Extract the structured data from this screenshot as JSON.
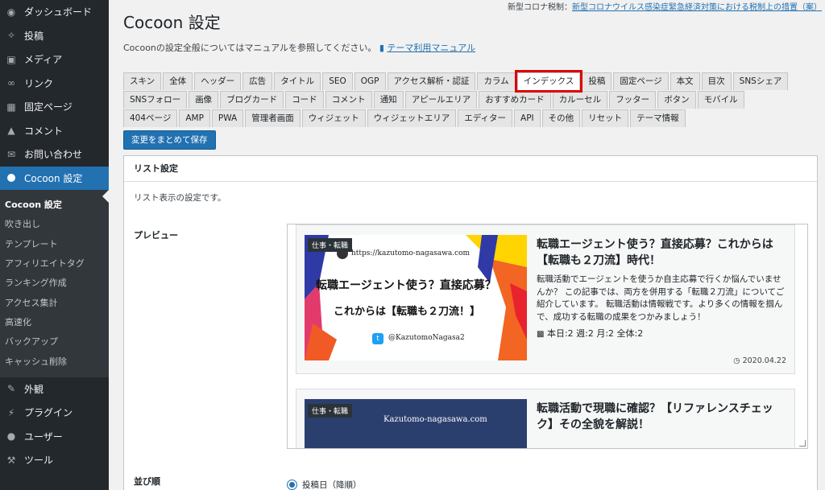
{
  "sidebar": {
    "top_items": [
      {
        "label": "ダッシュボード",
        "icon": "dashboard-icon"
      },
      {
        "label": "投稿",
        "icon": "pin-icon"
      },
      {
        "label": "メディア",
        "icon": "media-icon"
      },
      {
        "label": "リンク",
        "icon": "link-icon"
      },
      {
        "label": "固定ページ",
        "icon": "page-icon"
      },
      {
        "label": "コメント",
        "icon": "comment-icon"
      },
      {
        "label": "お問い合わせ",
        "icon": "mail-icon"
      }
    ],
    "active_item": {
      "label": "Cocoon 設定",
      "icon": "cocoon-icon"
    },
    "submenu": [
      "Cocoon 設定",
      "吹き出し",
      "テンプレート",
      "アフィリエイトタグ",
      "ランキング作成",
      "アクセス集計",
      "高速化",
      "バックアップ",
      "キャッシュ削除"
    ],
    "bottom_items": [
      {
        "label": "外観",
        "icon": "appearance-icon"
      },
      {
        "label": "プラグイン",
        "icon": "plugin-icon"
      },
      {
        "label": "ユーザー",
        "icon": "user-icon"
      },
      {
        "label": "ツール",
        "icon": "tool-icon"
      }
    ]
  },
  "notice": {
    "prefix": "新型コロナ税制：",
    "link": "新型コロナウイルス感染症緊急経済対策における税制上の措置（案）"
  },
  "page_title": "Cocoon 設定",
  "intro": {
    "text": "Cocoonの設定全般についてはマニュアルを参照してください。",
    "link": "テーマ利用マニュアル"
  },
  "tabs": {
    "row1": [
      "スキン",
      "全体",
      "ヘッダー",
      "広告",
      "タイトル",
      "SEO",
      "OGP",
      "アクセス解析・認証",
      "カラム",
      "インデックス",
      "投稿",
      "固定ページ",
      "本文",
      "目次",
      "SNSシェア"
    ],
    "row2": [
      "SNSフォロー",
      "画像",
      "ブログカード",
      "コード",
      "コメント",
      "通知",
      "アピールエリア",
      "おすすめカード",
      "カルーセル",
      "フッター",
      "ボタン",
      "モバイル"
    ],
    "row3": [
      "404ページ",
      "AMP",
      "PWA",
      "管理者画面",
      "ウィジェット",
      "ウィジェットエリア",
      "エディター",
      "API",
      "その他",
      "リセット",
      "テーマ情報"
    ],
    "active": "インデックス"
  },
  "save_button": "変更をまとめて保存",
  "panel": {
    "heading": "リスト設定",
    "description": "リスト表示の設定です。",
    "preview_label": "プレビュー",
    "order_label": "並び順",
    "order_option": "投稿日（降順）"
  },
  "card1": {
    "category": "仕事・転職",
    "thumb_url": "https://kazutomo-nagasawa.com",
    "thumb_line1": "転職エージェント使う？直接応募？",
    "thumb_line2": "これからは【転職も２刀流！】",
    "thumb_handle": "@KazutomoNagasa2",
    "title": "転職エージェント使う？直接応募？これからは【転職も２刀流】時代！",
    "snippet": "転職活動でエージェントを使うか自主応募で行くか悩んでいませんか？ この記事では、両方を併用する「転職２刀流」についてご紹介しています。 転職活動は情報戦です。より多くの情報を掴んで、成功する転職の成果をつかみましょう！",
    "stats": "本日:2  週:2  月:2  全体:2",
    "date": "2020.04.22"
  },
  "card2": {
    "category": "仕事・転職",
    "site": "Kazutomo-nagasawa.com",
    "title": "転職活動で現職に確認？【リファレンスチェック】その全貌を解説！"
  },
  "colors": {
    "accent": "#2271b1",
    "highlight": "#dd0000",
    "sidebar": "#23282d"
  }
}
